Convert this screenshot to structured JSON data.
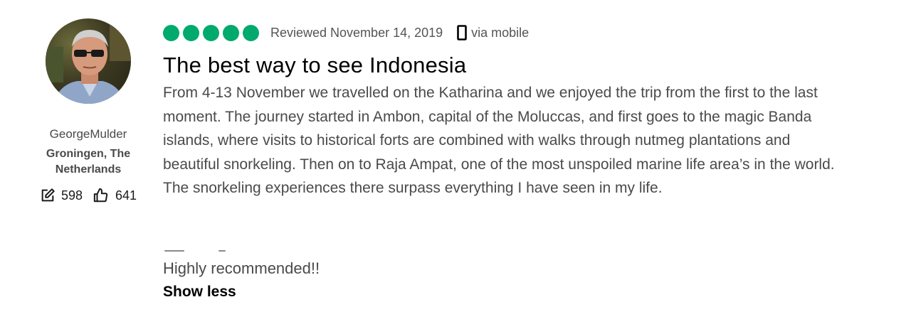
{
  "author": {
    "username": "GeorgeMulder",
    "location": "Groningen, The Netherlands",
    "contributions_count": "598",
    "helpful_votes_count": "641"
  },
  "review": {
    "rating": 5,
    "rating_max": 5,
    "rating_color": "#00aa6c",
    "date_text": "Reviewed November 14, 2019",
    "via_text": "via mobile",
    "title": "The best way to see Indonesia",
    "body": "From 4-13 November we travelled on the Katharina and we enjoyed the trip from the first to the last moment. The journey started in Ambon, capital of the Moluccas, and first goes to the magic Banda islands, where visits to historical forts are combined with walks through nutmeg plantations and beautiful snorkeling. Then on to Raja Ampat, one of the most unspoiled marine life area’s in the world. The snorkeling experiences there surpass everything I have seen in my life.",
    "closing": "Highly recommended!!",
    "show_less_label": "Show less"
  }
}
